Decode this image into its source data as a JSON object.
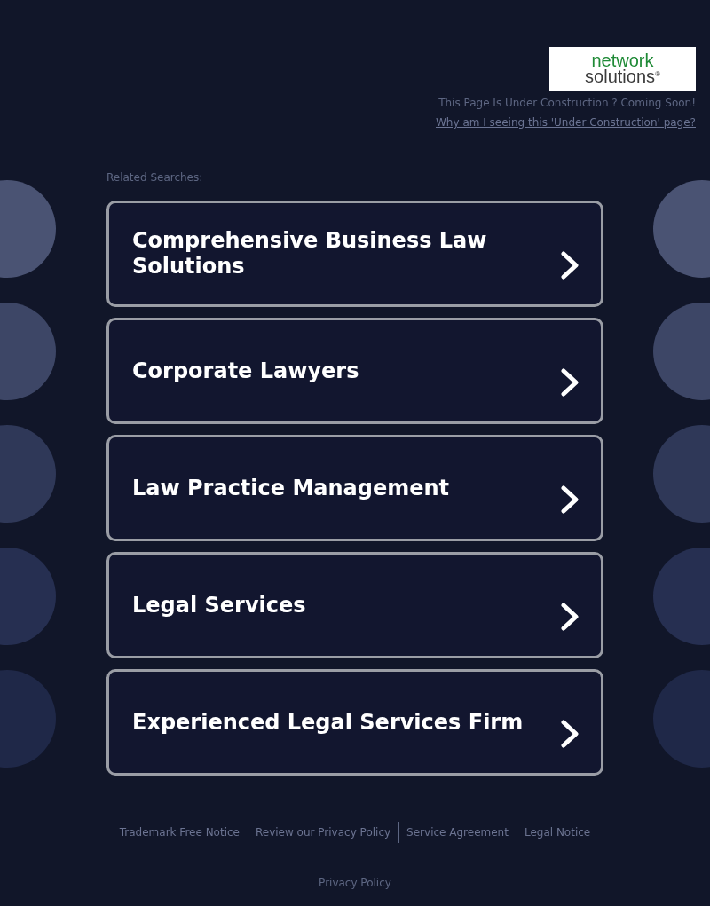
{
  "header": {
    "logo": {
      "line_1": "network",
      "line_2": "solutions$^{®}$"
    },
    "notice": "This Page Is Under Construction ? Coming Soon!",
    "info_link": "Why am I seeing this 'Under Construction' page?"
  },
  "related_searches": {
    "heading": "Related Searches:",
    "items": [
      "Comprehensive Business Law Solutions",
      "Corporate Lawyers",
      "Law Practice Management",
      "Legal Services",
      "Experienced Legal Services Firm"
    ]
  },
  "footer": {
    "links": [
      "Trademark Free Notice",
      "Review our Privacy Policy",
      "Service Agreement",
      "Legal Notice"
    ],
    "privacy_link": "Privacy Policy"
  }
}
